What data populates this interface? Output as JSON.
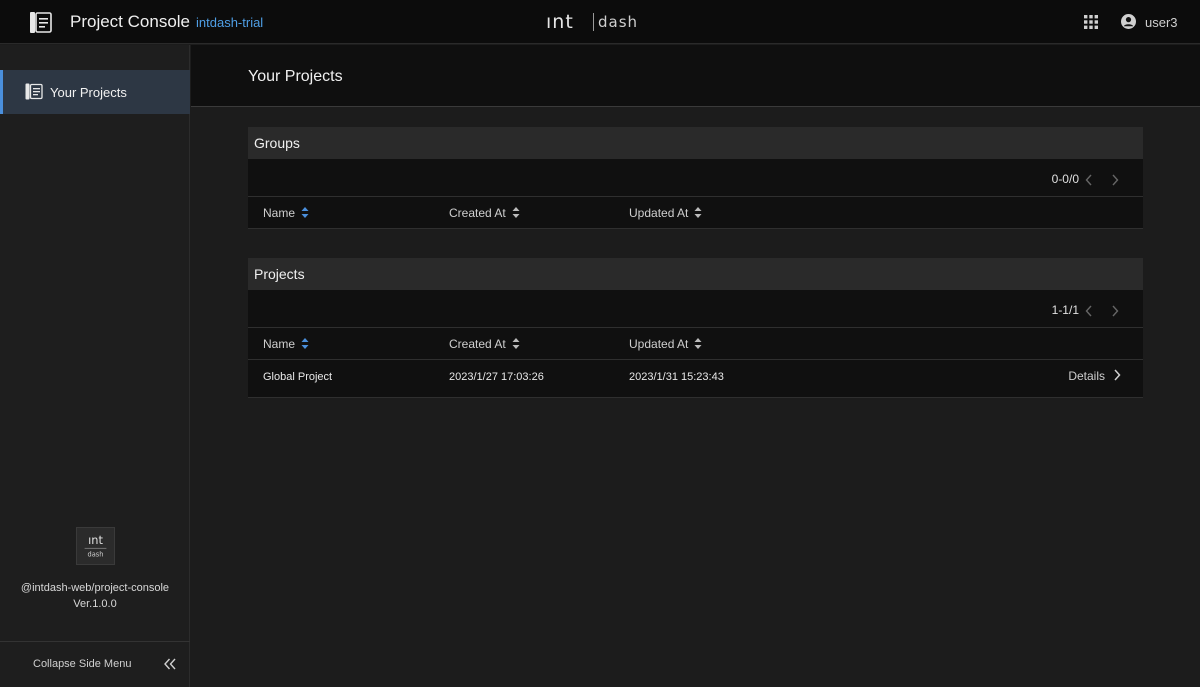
{
  "header": {
    "app_title": "Project Console",
    "tenant": "intdash-trial",
    "brand_left": "ınt",
    "brand_right": "dash",
    "user_name": "user3"
  },
  "sidebar": {
    "items": [
      {
        "label": "Your Projects",
        "icon": "document-list-icon",
        "active": true
      }
    ],
    "logo_top": "ınt",
    "logo_bottom": "dash",
    "package_name": "@intdash-web/project-console",
    "version": "Ver.1.0.0",
    "collapse_label": "Collapse Side Menu"
  },
  "main": {
    "title": "Your Projects",
    "groups": {
      "title": "Groups",
      "pager": "0-0/0",
      "columns": [
        "Name",
        "Created At",
        "Updated At"
      ],
      "rows": []
    },
    "projects": {
      "title": "Projects",
      "pager": "1-1/1",
      "columns": [
        "Name",
        "Created At",
        "Updated At"
      ],
      "rows": [
        {
          "name": "Global Project",
          "created_at": "2023/1/27 17:03:26",
          "updated_at": "2023/1/31 15:23:43",
          "action": "Details"
        }
      ]
    }
  },
  "colors": {
    "accent": "#4a8fdc",
    "tenant_link": "#4f9fe6",
    "header_bg": "#0c0c0c",
    "sidebar_bg": "#1e1e1e",
    "nav_active_bg": "#2d3744",
    "panel_head_bg": "#2a2a2a",
    "panel_bg": "#101010",
    "page_bg": "#1c1c1c"
  }
}
